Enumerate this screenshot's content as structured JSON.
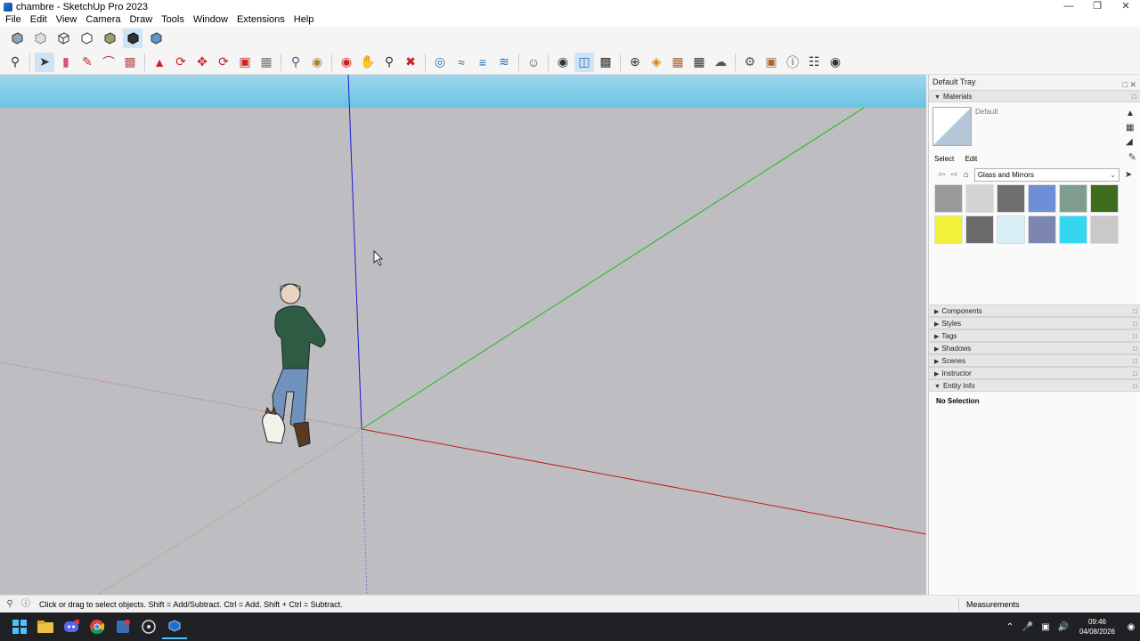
{
  "window": {
    "title": "chambre - SketchUp Pro 2023"
  },
  "menu": {
    "items": [
      "File",
      "Edit",
      "View",
      "Camera",
      "Draw",
      "Tools",
      "Window",
      "Extensions",
      "Help"
    ]
  },
  "toolbar1": {
    "icons": [
      "xray-icon",
      "back-edges-icon",
      "wireframe-icon",
      "hidden-line-icon",
      "shaded-icon",
      "shaded-textures-icon",
      "monochrome-icon"
    ]
  },
  "toolbar2": {
    "icons": [
      "zoom-icon",
      "select-icon",
      "eraser-icon",
      "pencil-line-icon",
      "arc-icon",
      "rectangle-icon",
      "push-pull-icon",
      "follow-me-icon",
      "move-icon",
      "rotate-icon",
      "scale-icon",
      "offset-icon",
      "tape-measure-icon",
      "paint-bucket-icon",
      "orbit-icon",
      "pan-icon",
      "zoom-window-icon",
      "zoom-extents-icon",
      "section-plane-icon",
      "section-cut-icon",
      "section-display-icon",
      "section-fill-icon",
      "user-icon",
      "3d-warehouse-icon",
      "extension-warehouse-icon",
      "layout-icon",
      "extension-manager-icon",
      "trimble-connect-icon",
      "outliner-icon",
      "components-icon",
      "cloud-icon",
      "preferences-icon",
      "scene-icon",
      "info-icon",
      "cart-icon",
      "account-icon"
    ]
  },
  "tray": {
    "title": "Default Tray",
    "materials": {
      "header": "Materials",
      "current_name": "Default",
      "tab_select": "Select",
      "tab_edit": "Edit",
      "collection": "Glass and Mirrors",
      "swatches": [
        "#9a9a9a",
        "#d4d4d4",
        "#6f6f6f",
        "#6d8fd8",
        "#7f9e8f",
        "#3e6d1e",
        "#f2f23a",
        "#6a6a6a",
        "#d7eef4",
        "#7c86b0",
        "#34d6f0",
        "#c9c9c9"
      ]
    },
    "collapsed_panels": [
      "Components",
      "Styles",
      "Tags",
      "Shadows",
      "Scenes",
      "Instructor"
    ],
    "entity_info": {
      "header": "Entity Info",
      "body": "No Selection"
    }
  },
  "status": {
    "hint": "Click or drag to select objects. Shift = Add/Subtract. Ctrl = Add. Shift + Ctrl = Subtract.",
    "measurements_label": "Measurements"
  },
  "taskbar": {
    "clock_time": "09:46",
    "clock_date": "04/08/2026",
    "apps": [
      "start-icon",
      "file-explorer-icon",
      "discord-icon",
      "chrome-icon",
      "app-icon",
      "obs-icon",
      "sketchup-icon"
    ]
  }
}
